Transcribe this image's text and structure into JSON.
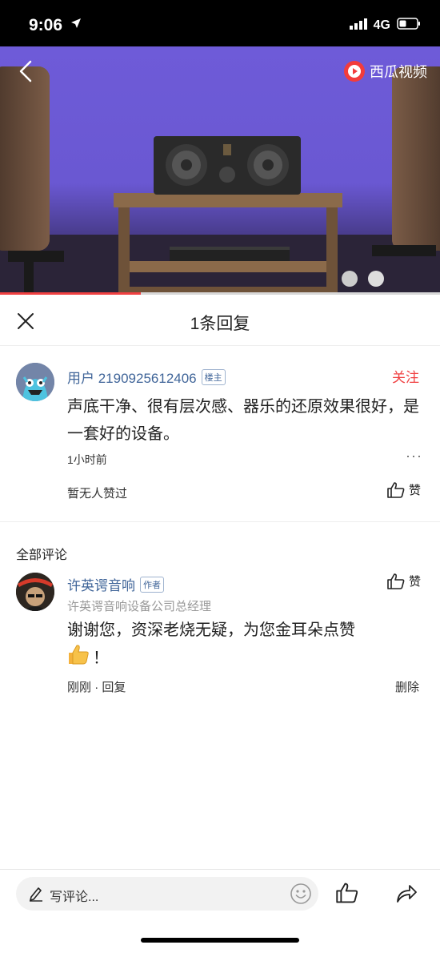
{
  "status_bar": {
    "time": "9:06",
    "network": "4G"
  },
  "video": {
    "brand_name": "西瓜视频",
    "progress": 0.32
  },
  "header": {
    "title": "1条回复"
  },
  "main_comment": {
    "username": "用户 2190925612406",
    "tag": "楼主",
    "follow_label": "关注",
    "text": "声底干净、很有层次感、器乐的还原效果很好，是一套好的设备。",
    "time": "1小时前",
    "more": "···",
    "likes_text": "暂无人赞过",
    "like_label": "赞"
  },
  "all_comments": {
    "title": "全部评论",
    "items": [
      {
        "username": "许英谔音响",
        "tag": "作者",
        "subtitle": "许英谔音响设备公司总经理",
        "text": "谢谢您，资深老烧无疑，为您金耳朵点赞",
        "text_suffix": "！",
        "time": "刚刚",
        "separator": "·",
        "reply_label": "回复",
        "like_label": "赞",
        "delete_label": "删除"
      }
    ]
  },
  "bottom_bar": {
    "placeholder": "写评论..."
  },
  "colors": {
    "accent_red": "#f04142",
    "link_blue": "#406599",
    "video_purple": "#6e5bd8"
  },
  "icons": [
    "location-arrow-icon",
    "signal-icon",
    "battery-icon",
    "back-chevron-icon",
    "xigua-logo-icon",
    "close-icon",
    "thumbs-up-icon",
    "pen-icon",
    "smile-icon",
    "share-icon"
  ]
}
